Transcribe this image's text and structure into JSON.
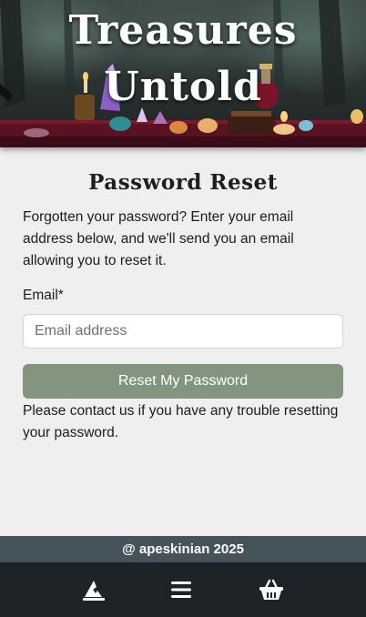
{
  "hero": {
    "title_line1": "Treasures",
    "title_line2": "Untold"
  },
  "main": {
    "title": "Password Reset",
    "intro": "Forgotten your password? Enter your email address below, and we'll send you an email allowing you to reset it.",
    "email_label": "Email*",
    "email_placeholder": "Email address",
    "email_value": "",
    "submit_label": "Reset My Password",
    "contact_text": "Please contact us if you have any trouble resetting your password."
  },
  "footer": {
    "copyright": "@ apeskinian 2025"
  },
  "bottom_nav": {
    "items": [
      {
        "icon": "wizard-hat-icon"
      },
      {
        "icon": "hamburger-menu-icon"
      },
      {
        "icon": "shopping-basket-icon"
      }
    ]
  },
  "colors": {
    "accent_button": "#84957f",
    "footer_strip": "#45545a",
    "bottom_nav": "#1d2327",
    "page_background": "#efefef"
  }
}
